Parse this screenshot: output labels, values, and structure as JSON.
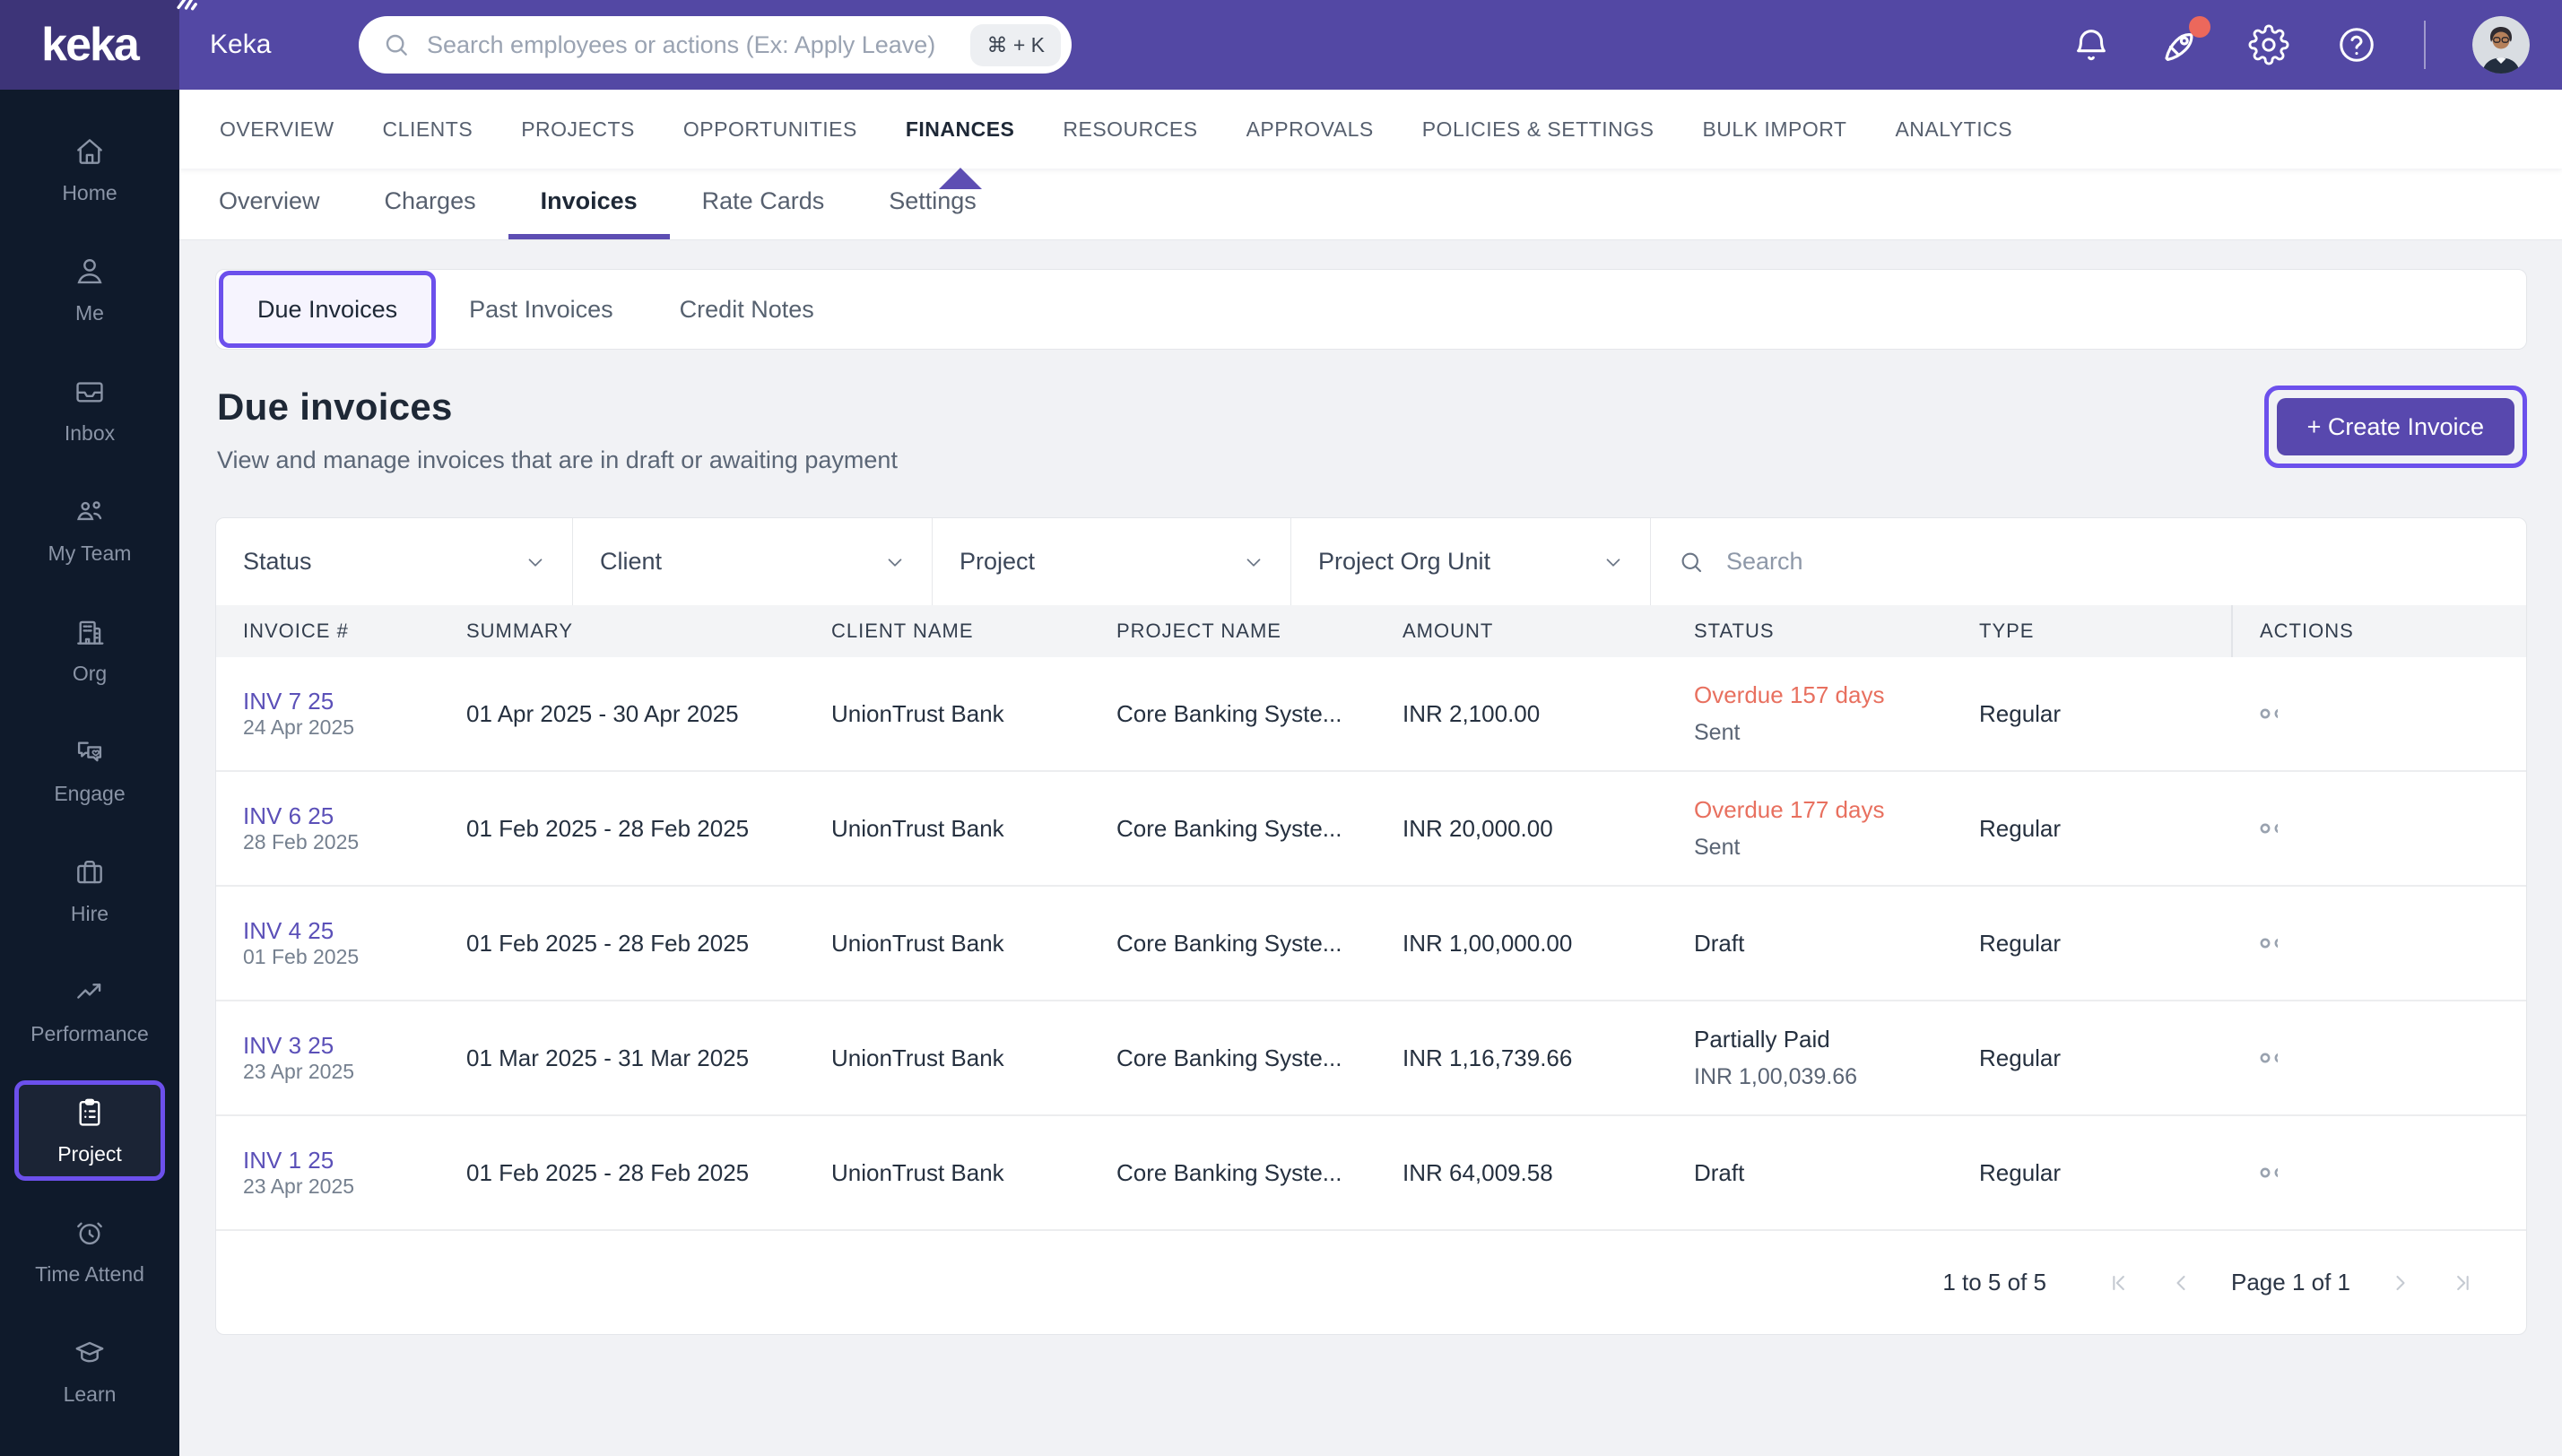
{
  "topbar": {
    "logo_text": "keka",
    "app_title": "Keka",
    "search_placeholder": "Search employees or actions (Ex: Apply Leave)",
    "shortcut_hint": "⌘ + K"
  },
  "sidebar": {
    "active": "Project",
    "items": [
      {
        "label": "Home"
      },
      {
        "label": "Me"
      },
      {
        "label": "Inbox"
      },
      {
        "label": "My Team"
      },
      {
        "label": "Org"
      },
      {
        "label": "Engage"
      },
      {
        "label": "Hire"
      },
      {
        "label": "Performance"
      },
      {
        "label": "Project"
      },
      {
        "label": "Time Attend"
      },
      {
        "label": "Learn"
      }
    ]
  },
  "main_nav": {
    "active": "FINANCES",
    "tabs": [
      {
        "label": "OVERVIEW"
      },
      {
        "label": "CLIENTS"
      },
      {
        "label": "PROJECTS"
      },
      {
        "label": "OPPORTUNITIES"
      },
      {
        "label": "FINANCES"
      },
      {
        "label": "RESOURCES"
      },
      {
        "label": "APPROVALS"
      },
      {
        "label": "POLICIES & SETTINGS"
      },
      {
        "label": "BULK IMPORT"
      },
      {
        "label": "ANALYTICS"
      }
    ]
  },
  "sub_nav": {
    "active": "Invoices",
    "tabs": [
      {
        "label": "Overview"
      },
      {
        "label": "Charges"
      },
      {
        "label": "Invoices"
      },
      {
        "label": "Rate Cards"
      },
      {
        "label": "Settings"
      }
    ]
  },
  "invoice_tabs": {
    "active": "Due Invoices",
    "tabs": [
      {
        "label": "Due Invoices"
      },
      {
        "label": "Past Invoices"
      },
      {
        "label": "Credit Notes"
      }
    ]
  },
  "page": {
    "title": "Due invoices",
    "subtitle": "View and manage invoices that are in draft or awaiting payment",
    "create_button": "+ Create Invoice"
  },
  "filters": {
    "status": "Status",
    "client": "Client",
    "project": "Project",
    "org_unit": "Project Org Unit",
    "search_placeholder": "Search"
  },
  "table": {
    "columns": {
      "invoice": "INVOICE #",
      "summary": "SUMMARY",
      "client": "CLIENT NAME",
      "project": "PROJECT NAME",
      "amount": "AMOUNT",
      "status": "STATUS",
      "type": "TYPE",
      "actions": "ACTIONS"
    },
    "rows": [
      {
        "invoice_no": "INV 7 25",
        "invoice_date": "24 Apr 2025",
        "summary": "01 Apr 2025 - 30 Apr 2025",
        "client": "UnionTrust Bank",
        "project": "Core Banking Syste...",
        "amount": "INR 2,100.00",
        "status": "Overdue 157 days",
        "status_sub": "Sent",
        "type": "Regular"
      },
      {
        "invoice_no": "INV 6 25",
        "invoice_date": "28 Feb 2025",
        "summary": "01 Feb 2025 - 28 Feb 2025",
        "client": "UnionTrust Bank",
        "project": "Core Banking Syste...",
        "amount": "INR 20,000.00",
        "status": "Overdue 177 days",
        "status_sub": "Sent",
        "type": "Regular"
      },
      {
        "invoice_no": "INV 4 25",
        "invoice_date": "01 Feb 2025",
        "summary": "01 Feb 2025 - 28 Feb 2025",
        "client": "UnionTrust Bank",
        "project": "Core Banking Syste...",
        "amount": "INR 1,00,000.00",
        "status": "Draft",
        "status_sub": "",
        "type": "Regular"
      },
      {
        "invoice_no": "INV 3 25",
        "invoice_date": "23 Apr 2025",
        "summary": "01 Mar 2025 - 31 Mar 2025",
        "client": "UnionTrust Bank",
        "project": "Core Banking Syste...",
        "amount": "INR 1,16,739.66",
        "status": "Partially Paid",
        "status_sub": "INR 1,00,039.66",
        "type": "Regular"
      },
      {
        "invoice_no": "INV 1 25",
        "invoice_date": "23 Apr 2025",
        "summary": "01 Feb 2025 - 28 Feb 2025",
        "client": "UnionTrust Bank",
        "project": "Core Banking Syste...",
        "amount": "INR 64,009.58",
        "status": "Draft",
        "status_sub": "",
        "type": "Regular"
      }
    ]
  },
  "pagination": {
    "range": "1 to 5 of 5",
    "page": "Page 1 of 1"
  },
  "colors": {
    "accent_annotation": "#6C50EC",
    "topbar_purple": "#5348A4",
    "logo_block_purple": "#3D3478",
    "sidebar_navy": "#0F1A2B",
    "button_purple": "#5848AE",
    "overdue_red": "#E8705F",
    "link_purple": "#5B50B8"
  }
}
